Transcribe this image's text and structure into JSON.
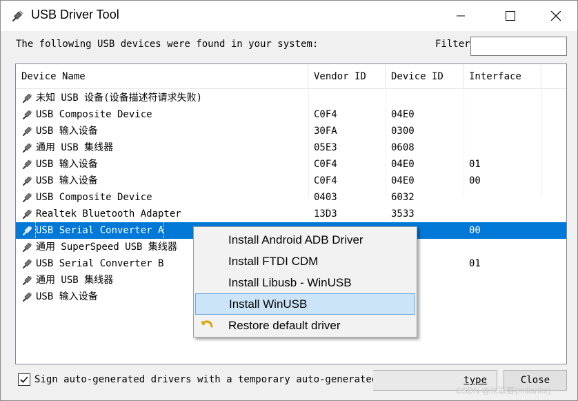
{
  "window": {
    "title": "USB Driver Tool"
  },
  "labels": {
    "found": "The following USB devices were found in your system:",
    "filter": "Filter"
  },
  "filter": {
    "value": "",
    "placeholder": ""
  },
  "columns": [
    "Device Name",
    "Vendor ID",
    "Device ID",
    "Interface"
  ],
  "devices": [
    {
      "name": "未知 USB 设备(设备描述符请求失败)",
      "vendor": "",
      "device": "",
      "iface": ""
    },
    {
      "name": "USB Composite Device",
      "vendor": "C0F4",
      "device": "04E0",
      "iface": ""
    },
    {
      "name": "USB 输入设备",
      "vendor": "30FA",
      "device": "0300",
      "iface": ""
    },
    {
      "name": "通用 USB 集线器",
      "vendor": "05E3",
      "device": "0608",
      "iface": ""
    },
    {
      "name": "USB 输入设备",
      "vendor": "C0F4",
      "device": "04E0",
      "iface": "01"
    },
    {
      "name": "USB 输入设备",
      "vendor": "C0F4",
      "device": "04E0",
      "iface": "00"
    },
    {
      "name": "USB Composite Device",
      "vendor": "0403",
      "device": "6032",
      "iface": ""
    },
    {
      "name": "Realtek Bluetooth Adapter",
      "vendor": "13D3",
      "device": "3533",
      "iface": ""
    },
    {
      "name": "USB Serial Converter A",
      "vendor": "",
      "device": "",
      "iface": "00",
      "selected": true
    },
    {
      "name": "通用 SuperSpeed USB 集线器",
      "vendor": "",
      "device": "",
      "iface": ""
    },
    {
      "name": "USB Serial Converter B",
      "vendor": "",
      "device": "",
      "iface": "01"
    },
    {
      "name": "通用 USB 集线器",
      "vendor": "",
      "device": "",
      "iface": ""
    },
    {
      "name": "USB 输入设备",
      "vendor": "",
      "device": "",
      "iface": ""
    }
  ],
  "context_menu": {
    "items": [
      {
        "label": "Install Android ADB Driver"
      },
      {
        "label": "Install FTDI CDM"
      },
      {
        "label": "Install Libusb - WinUSB"
      },
      {
        "label": "Install WinUSB",
        "highlighted": true
      },
      {
        "label": "Restore default driver",
        "icon": "undo-arrow-icon"
      }
    ]
  },
  "bottom": {
    "sign_checked": true,
    "sign_label": "Sign auto-generated drivers with a temporary auto-generated certificate",
    "type_label": "type",
    "close_label": "Close"
  },
  "watermark": "CSDN @米联客(milianke)",
  "colors": {
    "selection": "#0078d7",
    "menu_highlight": "#cce4f7",
    "menu_highlight_border": "#66a8e0"
  }
}
